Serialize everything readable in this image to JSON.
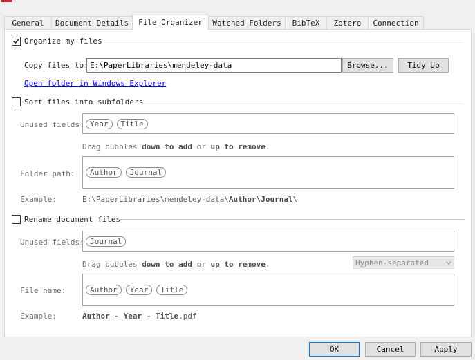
{
  "tabs": [
    {
      "label": "General"
    },
    {
      "label": "Document Details"
    },
    {
      "label": "File Organizer"
    },
    {
      "label": "Watched Folders"
    },
    {
      "label": "BibTeX"
    },
    {
      "label": "Zotero"
    },
    {
      "label": "Connection"
    }
  ],
  "active_tab": "File Organizer",
  "organize": {
    "title": "Organize my files",
    "checked": true,
    "copy_label": "Copy files to:",
    "copy_path": "E:\\PaperLibraries\\mendeley-data",
    "browse_label": "Browse...",
    "tidy_label": "Tidy Up",
    "open_folder_link": "Open folder in Windows Explorer"
  },
  "subfolders": {
    "title": "Sort files into subfolders",
    "checked": false,
    "unused_label": "Unused fields:",
    "unused_fields": [
      "Year",
      "Title"
    ],
    "hint_pre": "Drag bubbles ",
    "hint_b1": "down to add",
    "hint_mid": " or ",
    "hint_b2": "up to remove",
    "hint_post": ".",
    "path_label": "Folder path:",
    "path_fields": [
      "Author",
      "Journal"
    ],
    "example_label": "Example:",
    "example_pre": "E:\\PaperLibraries\\mendeley-data\\",
    "example_b1": "Author",
    "example_sep": "\\",
    "example_b2": "Journal",
    "example_post": "\\"
  },
  "rename": {
    "title": "Rename document files",
    "checked": false,
    "unused_label": "Unused fields:",
    "unused_fields": [
      "Journal"
    ],
    "hint_pre": "Drag bubbles ",
    "hint_b1": "down to add",
    "hint_mid": " or ",
    "hint_b2": "up to remove",
    "hint_post": ".",
    "separator_value": "Hyphen-separated",
    "name_label": "File name:",
    "name_fields": [
      "Author",
      "Year",
      "Title"
    ],
    "example_label": "Example:",
    "example_b1": "Author",
    "example_s1": " - ",
    "example_b2": "Year",
    "example_s2": " - ",
    "example_b3": "Title",
    "example_post": ".pdf"
  },
  "footer": {
    "ok_label": "OK",
    "cancel_label": "Cancel",
    "apply_label": "Apply"
  },
  "colors": {
    "accent": "#0078d7",
    "link": "#0000ee",
    "app_icon": "#c0282d"
  }
}
